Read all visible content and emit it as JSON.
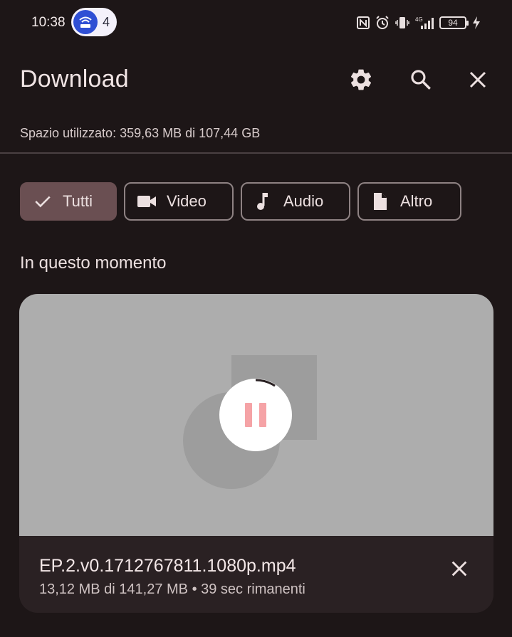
{
  "status_bar": {
    "time": "10:38",
    "notification_count": "4",
    "battery": "94",
    "icons": [
      "wifi-hotspot-icon",
      "nfc-icon",
      "alarm-icon",
      "vibrate-icon",
      "signal-4g-icon",
      "battery-icon",
      "charging-icon"
    ]
  },
  "header": {
    "title": "Download",
    "actions": [
      "settings-icon",
      "search-icon",
      "close-icon"
    ]
  },
  "storage": {
    "text": "Spazio utilizzato: 359,63 MB di 107,44 GB"
  },
  "filters": {
    "chips": [
      {
        "label": "Tutti",
        "icon": "check-icon",
        "selected": true
      },
      {
        "label": "Video",
        "icon": "video-icon",
        "selected": false
      },
      {
        "label": "Audio",
        "icon": "music-note-icon",
        "selected": false
      },
      {
        "label": "Altro",
        "icon": "file-icon",
        "selected": false
      }
    ]
  },
  "section": {
    "title": "In questo momento"
  },
  "download": {
    "file_name": "EP.2.v0.1712767811.1080p.mp4",
    "progress_text": "13,12 MB di 141,27 MB • 39 sec rimanenti",
    "progress_fraction": 0.093,
    "state": "downloading"
  },
  "colors": {
    "background": "#1d1617",
    "chip_selected": "#6a4f52",
    "pause_accent": "#f5a3a6",
    "thumbnail": "#adadad"
  }
}
